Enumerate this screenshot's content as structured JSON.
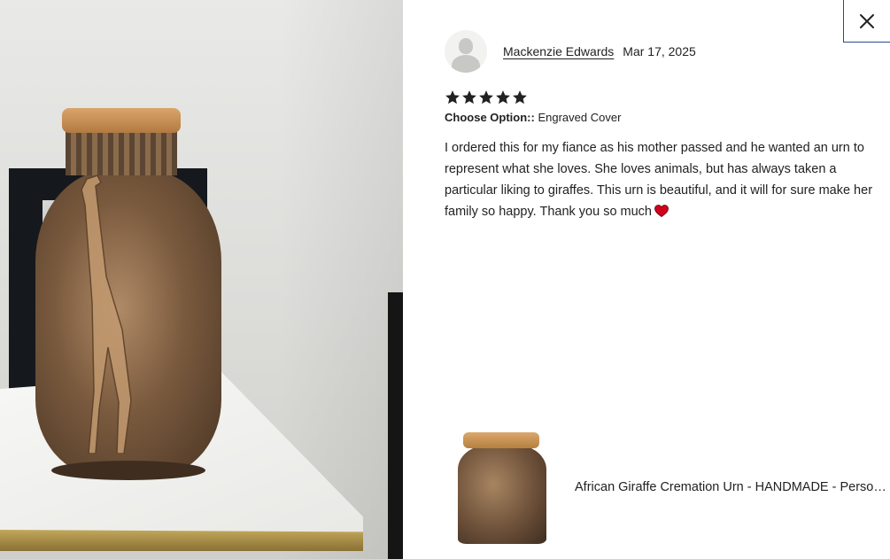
{
  "reviewer": {
    "name": "Mackenzie Edwards",
    "date": "Mar 17, 2025"
  },
  "rating": {
    "stars": 5,
    "max": 5
  },
  "option": {
    "label": "Choose Option::",
    "value": "Engraved Cover"
  },
  "review": {
    "text": "I ordered this for my fiance as his mother passed and he wanted an urn to represent what she loves. She loves animals, but has always taken a particular liking to giraffes. This urn is beautiful, and it will for sure make her family so happy. Thank you so much"
  },
  "product": {
    "title": "African Giraffe Cremation Urn - HANDMADE - Personalized Urn for Ashes"
  },
  "icons": {
    "close": "close-icon",
    "star": "star-icon",
    "heart": "heart-icon",
    "avatar": "user-avatar-icon"
  },
  "colors": {
    "star": "#222222",
    "heart": "#d0021b",
    "close_border": "#2b4a8a"
  }
}
